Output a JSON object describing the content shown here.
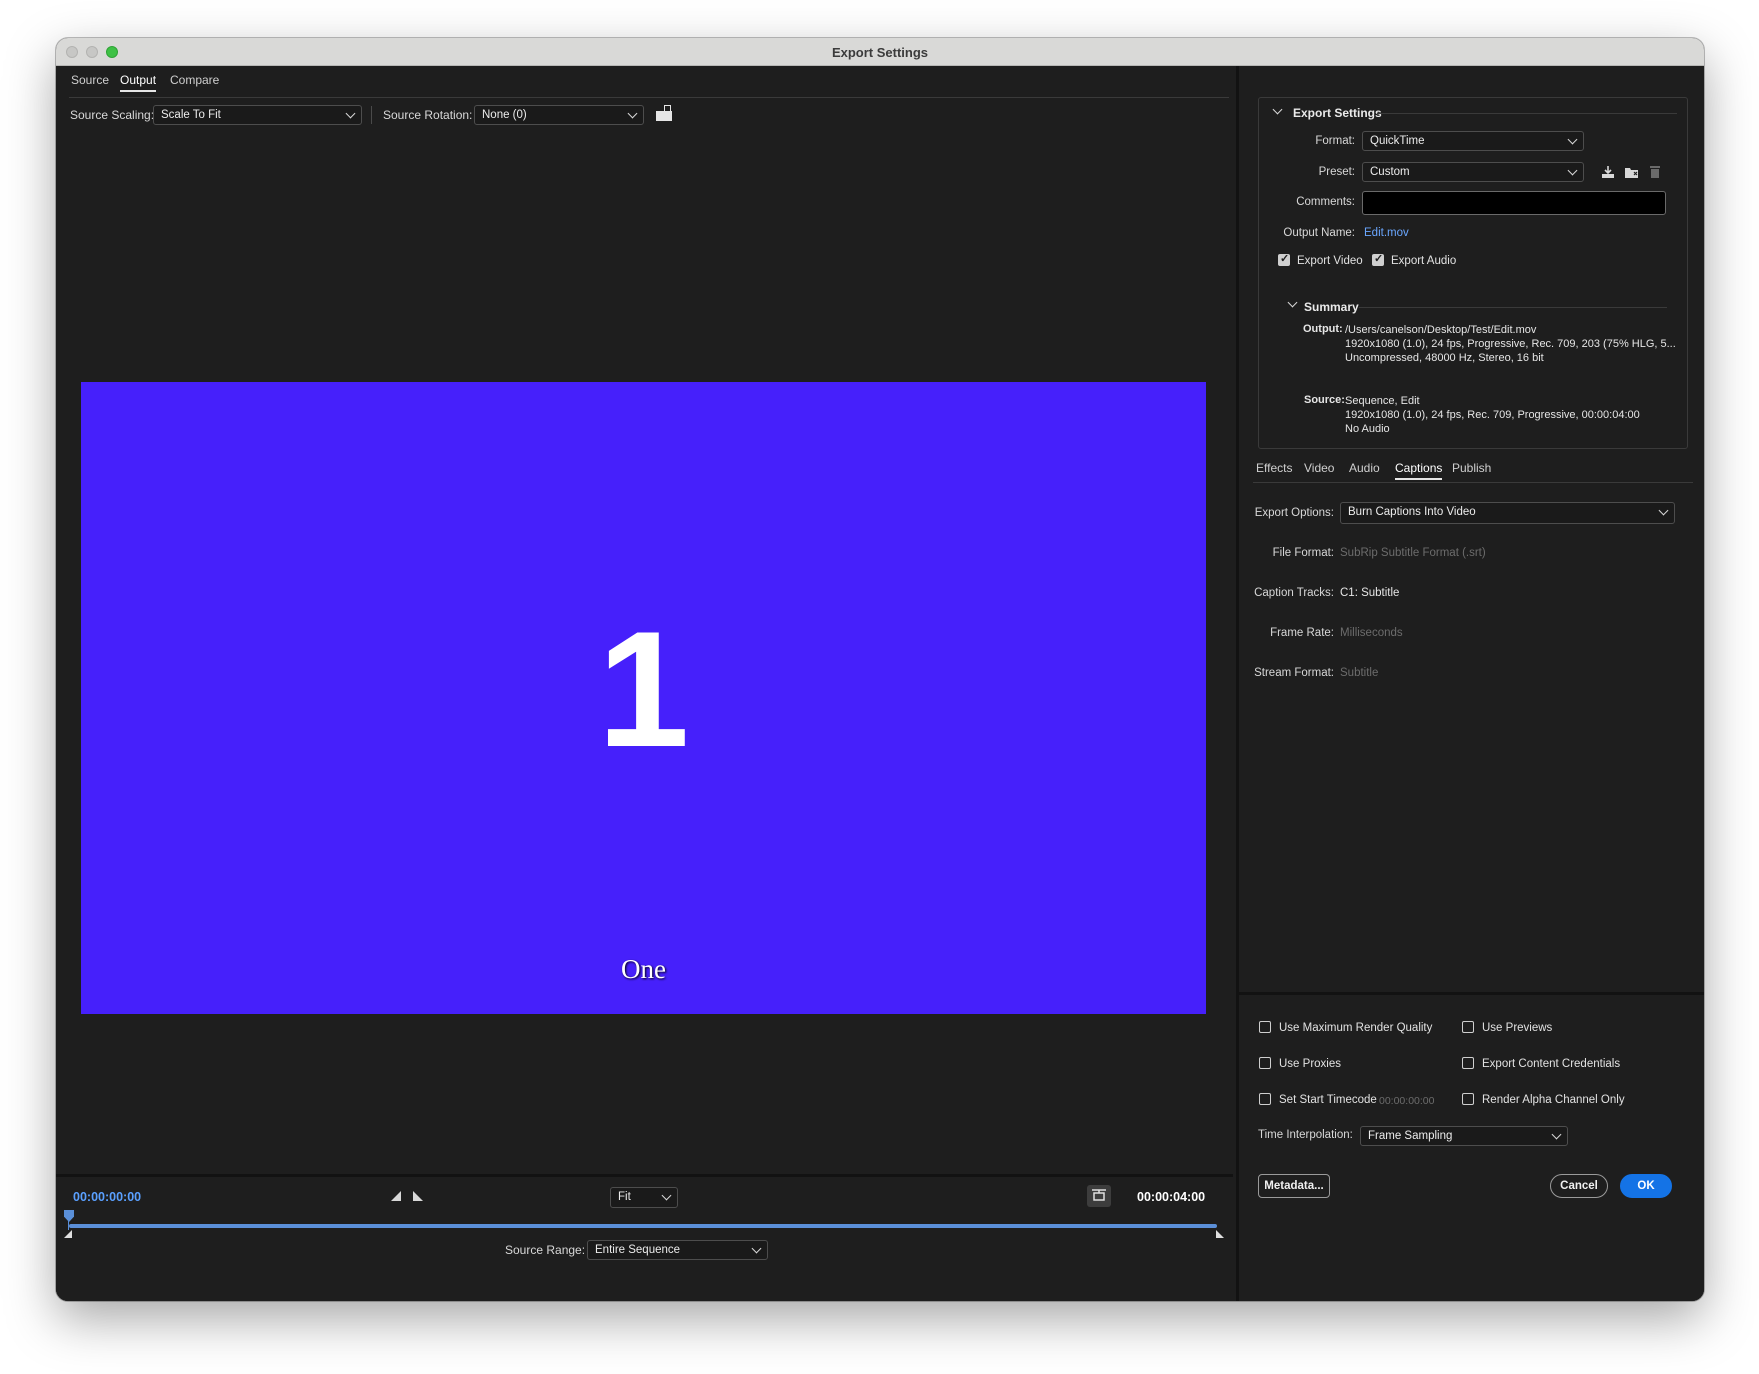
{
  "window": {
    "title": "Export Settings"
  },
  "left": {
    "tabs": [
      {
        "label": "Source",
        "active": false
      },
      {
        "label": "Output",
        "active": true
      },
      {
        "label": "Compare",
        "active": false
      }
    ],
    "source_scaling_label": "Source Scaling:",
    "source_scaling_value": "Scale To Fit",
    "source_rotation_label": "Source Rotation:",
    "source_rotation_value": "None (0)",
    "preview": {
      "background_color": "#4620fb",
      "big_text": "1",
      "caption": "One"
    }
  },
  "timeline": {
    "current_timecode": "00:00:00:00",
    "end_timecode": "00:00:04:00",
    "zoom_value": "Fit",
    "source_range_label": "Source Range:",
    "source_range_value": "Entire Sequence"
  },
  "export_settings": {
    "heading": "Export Settings",
    "format_label": "Format:",
    "format_value": "QuickTime",
    "preset_label": "Preset:",
    "preset_value": "Custom",
    "comments_label": "Comments:",
    "comments_value": "",
    "output_name_label": "Output Name:",
    "output_name_value": "Edit.mov",
    "export_video_label": "Export Video",
    "export_video_checked": true,
    "export_audio_label": "Export Audio",
    "export_audio_checked": true
  },
  "summary": {
    "heading": "Summary",
    "output_key": "Output:",
    "output_lines": [
      "/Users/canelson/Desktop/Test/Edit.mov",
      "1920x1080 (1.0), 24 fps, Progressive, Rec. 709, 203 (75% HLG, 5...",
      "Uncompressed, 48000 Hz, Stereo, 16 bit"
    ],
    "source_key": "Source:",
    "source_lines": [
      "Sequence, Edit",
      "1920x1080 (1.0), 24 fps, Rec. 709, Progressive, 00:00:04:00",
      "No Audio"
    ]
  },
  "right_tabs": [
    {
      "label": "Effects",
      "active": false
    },
    {
      "label": "Video",
      "active": false
    },
    {
      "label": "Audio",
      "active": false
    },
    {
      "label": "Captions",
      "active": true
    },
    {
      "label": "Publish",
      "active": false
    }
  ],
  "captions": {
    "export_options_label": "Export Options:",
    "export_options_value": "Burn Captions Into Video",
    "file_format_label": "File Format:",
    "file_format_value": "SubRip Subtitle Format (.srt)",
    "caption_tracks_label": "Caption Tracks:",
    "caption_tracks_value": "C1: Subtitle",
    "frame_rate_label": "Frame Rate:",
    "frame_rate_value": "Milliseconds",
    "stream_format_label": "Stream Format:",
    "stream_format_value": "Subtitle"
  },
  "render_options": {
    "use_max_render_quality": "Use Maximum Render Quality",
    "use_previews": "Use Previews",
    "use_proxies": "Use Proxies",
    "export_content_credentials": "Export Content Credentials",
    "set_start_timecode": "Set Start Timecode",
    "start_timecode_value": "00:00:00:00",
    "render_alpha_channel_only": "Render Alpha Channel Only",
    "time_interpolation_label": "Time Interpolation:",
    "time_interpolation_value": "Frame Sampling"
  },
  "buttons": {
    "metadata": "Metadata...",
    "cancel": "Cancel",
    "ok": "OK"
  },
  "colors": {
    "accent": "#1473e6",
    "timecode_blue": "#5aa0ff",
    "link_blue": "#6aa7ff",
    "panel_bg": "#1e1e1e"
  },
  "icons": [
    "chevron-down-icon",
    "rotate-icon",
    "mark-in-icon",
    "mark-out-icon",
    "fit-frame-icon",
    "save-preset-icon",
    "import-preset-icon",
    "delete-preset-icon",
    "checkbox-icon"
  ]
}
